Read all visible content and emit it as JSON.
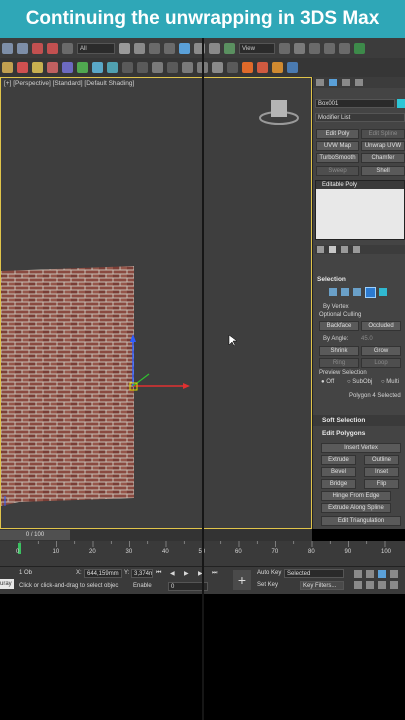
{
  "banner": {
    "title": "Continuing the unwrapping in 3DS Max",
    "color": "#2fa7b7"
  },
  "main_toolbar": {
    "selection_filter": "All",
    "ref_coord": "View"
  },
  "viewport": {
    "label": "[+] [Perspective] [Standard] [Default Shading]",
    "object": "brick wall plane",
    "border_color": "#e0c44a"
  },
  "command_panel": {
    "object_name": "Box001",
    "object_color": "#2dc6d6",
    "modifier_list_label": "Modifier List",
    "buttons": {
      "edit_poly": "Edit Poly",
      "edit_spline": "Edit Spline",
      "uvw_map": "UVW Map",
      "unwrap_uvw": "Unwrap UVW",
      "turbosmooth": "TurboSmooth",
      "chamfer": "Chamfer",
      "sweep": "Sweep",
      "shell": "Shell"
    },
    "stack_item": "Editable Poly",
    "selection": {
      "header": "Selection",
      "by_vertex": "By Vertex",
      "optional_culling": "Optional Culling",
      "backface": "Backface",
      "occluded": "Occluded",
      "by_angle": "By Angle:",
      "angle_value": "45.0",
      "shrink": "Shrink",
      "grow": "Grow",
      "ring": "Ring",
      "loop": "Loop",
      "preview_selection": "Preview Selection",
      "off": "Off",
      "subobj": "SubObj",
      "multi": "Multi",
      "status": "Polygon 4 Selected"
    },
    "soft_selection_header": "Soft Selection",
    "edit_polygons": {
      "header": "Edit Polygons",
      "insert_vertex": "Insert Vertex",
      "extrude": "Extrude",
      "outline": "Outline",
      "bevel": "Bevel",
      "inset": "Inset",
      "bridge": "Bridge",
      "flip": "Flip",
      "hinge_from_edge": "Hinge From Edge",
      "extrude_along_spline": "Extrude Along Spline",
      "edit_triangulation": "Edit Triangulation"
    }
  },
  "timeline": {
    "frame_display": "0 / 100",
    "ticks": [
      "0",
      "10",
      "20",
      "30",
      "40",
      "50",
      "60",
      "70",
      "80",
      "90",
      "100"
    ]
  },
  "status_bar": {
    "objects_selected": "1 Ob",
    "script_label": "uray",
    "prompt": "Click or click-and-drag to select objec",
    "x_label": "X:",
    "x_value": "644,159mm",
    "y_label": "Y:",
    "y_value": "3,374m",
    "enable_label": "Enable",
    "angle_value": "0",
    "auto_key": "Auto Key",
    "set_key": "Set Key",
    "key_mode": "Selected",
    "key_filters": "Key Filters..."
  }
}
